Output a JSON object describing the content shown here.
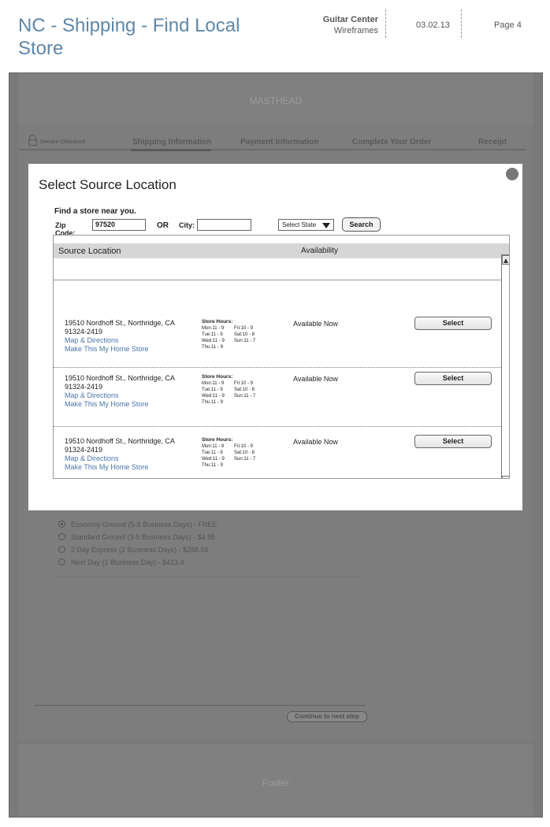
{
  "doc": {
    "title": "NC - Shipping - Find Local Store",
    "company": "Guitar Center",
    "subtitle": "Wireframes",
    "date": "03.02.13",
    "page": "Page 4"
  },
  "masthead": "MASTHEAD",
  "footer": "Footer",
  "checkout_steps": {
    "secure": "Secure Checkout",
    "shipping": "Shipping Information",
    "payment": "Payment Information",
    "complete": "Complete Your Order",
    "receipt": "Receipt"
  },
  "shipping_options": [
    {
      "label": "Economy Ground (5-8 Business Days) - FREE",
      "selected": true
    },
    {
      "label": "Standard Ground (3-5 Business Days) - $4.95",
      "selected": false
    },
    {
      "label": "2 Day Express (2 Business Days) - $288.56",
      "selected": false
    },
    {
      "label": "Next Day (1 Business Day) - $413.4",
      "selected": false
    }
  ],
  "continue_label": "Continue to next step",
  "modal": {
    "title": "Select Source Location",
    "find_label": "Find a store near you.",
    "zip_label": "Zip Code:",
    "zip_value": "97520",
    "or_label": "OR",
    "city_label": "City:",
    "city_value": "",
    "state_label": "Select State",
    "search_label": "Search",
    "col_location": "Source Location",
    "col_availability": "Availability",
    "stores": [
      {
        "address1": "19510 Nordhoff St., Northridge, CA",
        "address2": "91324-2419",
        "map_link": "Map & Directions",
        "home_link": "Make This My Home Store",
        "hours_label": "Store Hours:",
        "hours": [
          "Mon:11 - 9",
          "Fri:10 - 9",
          "Tue:11 - 9",
          "Sat:10 - 8",
          "Wed:11 - 9",
          "Sun:11 - 7",
          "Thu:11 - 9"
        ],
        "availability": "Available Now",
        "select_label": "Select"
      },
      {
        "address1": "19510 Nordhoff St., Northridge, CA",
        "address2": "91324-2419",
        "map_link": "Map & Directions",
        "home_link": "Make This My Home Store",
        "hours_label": "Store Hours:",
        "hours": [
          "Mon:11 - 9",
          "Fri:10 - 9",
          "Tue:11 - 9",
          "Sat:10 - 8",
          "Wed:11 - 9",
          "Sun:11 - 7",
          "Thu:11 - 9"
        ],
        "availability": "Available Now",
        "select_label": "Select"
      },
      {
        "address1": "19510 Nordhoff St., Northridge, CA",
        "address2": "91324-2419",
        "map_link": "Map & Directions",
        "home_link": "Make This My Home Store",
        "hours_label": "Store Hours:",
        "hours": [
          "Mon:11 - 9",
          "Fri:10 - 9",
          "Tue:11 - 9",
          "Sat:10 - 8",
          "Wed:11 - 9",
          "Sun:11 - 7",
          "Thu:11 - 9"
        ],
        "availability": "Available Now",
        "select_label": "Select"
      }
    ]
  }
}
